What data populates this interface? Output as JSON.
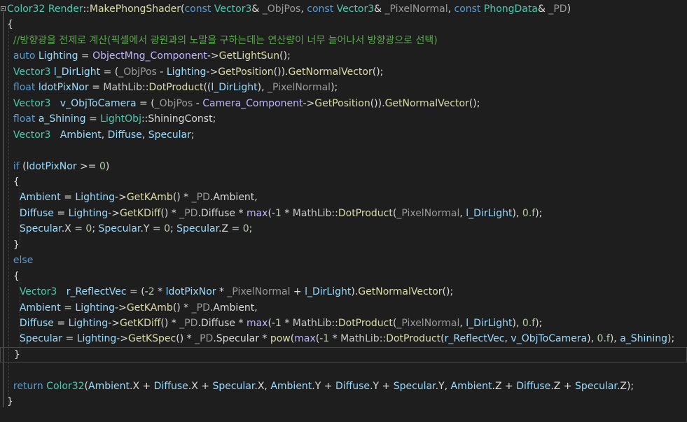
{
  "code": {
    "lines": [
      [
        {
          "t": "Color32",
          "c": "type"
        },
        {
          "t": " ",
          "c": "text"
        },
        {
          "t": "Render",
          "c": "type"
        },
        {
          "t": "::",
          "c": "text"
        },
        {
          "t": "MakePhongShader",
          "c": "func"
        },
        {
          "t": "(",
          "c": "text"
        },
        {
          "t": "const",
          "c": "keyword"
        },
        {
          "t": " ",
          "c": "text"
        },
        {
          "t": "Vector3",
          "c": "type"
        },
        {
          "t": "& ",
          "c": "text"
        },
        {
          "t": "_ObjPos",
          "c": "param"
        },
        {
          "t": ", ",
          "c": "text"
        },
        {
          "t": "const",
          "c": "keyword"
        },
        {
          "t": " ",
          "c": "text"
        },
        {
          "t": "Vector3",
          "c": "type"
        },
        {
          "t": "& ",
          "c": "text"
        },
        {
          "t": "_PixelNormal",
          "c": "param"
        },
        {
          "t": ", ",
          "c": "text"
        },
        {
          "t": "const",
          "c": "keyword"
        },
        {
          "t": " ",
          "c": "text"
        },
        {
          "t": "PhongData",
          "c": "type"
        },
        {
          "t": "& ",
          "c": "text"
        },
        {
          "t": "_PD",
          "c": "param"
        },
        {
          "t": ")",
          "c": "text"
        }
      ],
      [
        {
          "t": "{",
          "c": "text"
        }
      ],
      [
        {
          "t": "  ",
          "c": "text"
        },
        {
          "t": "//방향광을 전제로 계산(픽셀에서 광원과의 노말을 구하는데는 연산량이 너무 늘어나서 방향광으로 선택)",
          "c": "comment"
        }
      ],
      [
        {
          "t": "  ",
          "c": "text"
        },
        {
          "t": "auto",
          "c": "keyword"
        },
        {
          "t": " ",
          "c": "text"
        },
        {
          "t": "Lighting",
          "c": "variable"
        },
        {
          "t": " = ",
          "c": "text"
        },
        {
          "t": "ObjectMng_Component",
          "c": "macro"
        },
        {
          "t": "->",
          "c": "text"
        },
        {
          "t": "GetLightSun",
          "c": "func"
        },
        {
          "t": "();",
          "c": "text"
        }
      ],
      [
        {
          "t": "  ",
          "c": "text"
        },
        {
          "t": "Vector3",
          "c": "type"
        },
        {
          "t": " ",
          "c": "text"
        },
        {
          "t": "l_DirLight",
          "c": "variable"
        },
        {
          "t": " = (",
          "c": "text"
        },
        {
          "t": "_ObjPos",
          "c": "param"
        },
        {
          "t": " - ",
          "c": "text"
        },
        {
          "t": "Lighting",
          "c": "variable"
        },
        {
          "t": "->",
          "c": "text"
        },
        {
          "t": "GetPosition",
          "c": "func"
        },
        {
          "t": "()).",
          "c": "text"
        },
        {
          "t": "GetNormalVector",
          "c": "func"
        },
        {
          "t": "();",
          "c": "text"
        }
      ],
      [
        {
          "t": "  ",
          "c": "text"
        },
        {
          "t": "float",
          "c": "keyword"
        },
        {
          "t": " ",
          "c": "text"
        },
        {
          "t": "ldotPixNor",
          "c": "variable"
        },
        {
          "t": " = ",
          "c": "text"
        },
        {
          "t": "MathLib",
          "c": "namespace"
        },
        {
          "t": "::",
          "c": "text"
        },
        {
          "t": "DotProduct",
          "c": "func"
        },
        {
          "t": "((",
          "c": "text"
        },
        {
          "t": "l_DirLight",
          "c": "variable"
        },
        {
          "t": "), ",
          "c": "text"
        },
        {
          "t": "_PixelNormal",
          "c": "param"
        },
        {
          "t": ");",
          "c": "text"
        }
      ],
      [
        {
          "t": "  ",
          "c": "text"
        },
        {
          "t": "Vector3",
          "c": "type"
        },
        {
          "t": "   ",
          "c": "text"
        },
        {
          "t": "v_ObjToCamera",
          "c": "variable"
        },
        {
          "t": " = (",
          "c": "text"
        },
        {
          "t": "_ObjPos",
          "c": "param"
        },
        {
          "t": " - ",
          "c": "text"
        },
        {
          "t": "Camera_Component",
          "c": "macro"
        },
        {
          "t": "->",
          "c": "text"
        },
        {
          "t": "GetPosition",
          "c": "func"
        },
        {
          "t": "()).",
          "c": "text"
        },
        {
          "t": "GetNormalVector",
          "c": "func"
        },
        {
          "t": "();",
          "c": "text"
        }
      ],
      [
        {
          "t": "  ",
          "c": "text"
        },
        {
          "t": "float",
          "c": "keyword"
        },
        {
          "t": " ",
          "c": "text"
        },
        {
          "t": "a_Shining",
          "c": "variable"
        },
        {
          "t": " = ",
          "c": "text"
        },
        {
          "t": "LightObj",
          "c": "type"
        },
        {
          "t": "::",
          "c": "text"
        },
        {
          "t": "ShiningConst",
          "c": "member"
        },
        {
          "t": ";",
          "c": "text"
        }
      ],
      [
        {
          "t": "  ",
          "c": "text"
        },
        {
          "t": "Vector3",
          "c": "type"
        },
        {
          "t": "   ",
          "c": "text"
        },
        {
          "t": "Ambient",
          "c": "variable"
        },
        {
          "t": ", ",
          "c": "text"
        },
        {
          "t": "Diffuse",
          "c": "variable"
        },
        {
          "t": ", ",
          "c": "text"
        },
        {
          "t": "Specular",
          "c": "variable"
        },
        {
          "t": ";",
          "c": "text"
        }
      ],
      [
        {
          "t": "",
          "c": "text"
        }
      ],
      [
        {
          "t": "  ",
          "c": "text"
        },
        {
          "t": "if",
          "c": "keyword"
        },
        {
          "t": " (",
          "c": "text"
        },
        {
          "t": "ldotPixNor",
          "c": "variable"
        },
        {
          "t": " >= ",
          "c": "text"
        },
        {
          "t": "0",
          "c": "number"
        },
        {
          "t": ")",
          "c": "text"
        }
      ],
      [
        {
          "t": "  {",
          "c": "text"
        }
      ],
      [
        {
          "t": "    ",
          "c": "text"
        },
        {
          "t": "Ambient",
          "c": "variable"
        },
        {
          "t": " = ",
          "c": "text"
        },
        {
          "t": "Lighting",
          "c": "variable"
        },
        {
          "t": "->",
          "c": "text"
        },
        {
          "t": "GetKAmb",
          "c": "func"
        },
        {
          "t": "() * ",
          "c": "text"
        },
        {
          "t": "_PD",
          "c": "param"
        },
        {
          "t": ".",
          "c": "text"
        },
        {
          "t": "Ambient",
          "c": "member"
        },
        {
          "t": ",",
          "c": "text"
        }
      ],
      [
        {
          "t": "    ",
          "c": "text"
        },
        {
          "t": "Diffuse",
          "c": "variable"
        },
        {
          "t": " = ",
          "c": "text"
        },
        {
          "t": "Lighting",
          "c": "variable"
        },
        {
          "t": "->",
          "c": "text"
        },
        {
          "t": "GetKDiff",
          "c": "func"
        },
        {
          "t": "() * ",
          "c": "text"
        },
        {
          "t": "_PD",
          "c": "param"
        },
        {
          "t": ".",
          "c": "text"
        },
        {
          "t": "Diffuse",
          "c": "member"
        },
        {
          "t": " * ",
          "c": "text"
        },
        {
          "t": "max",
          "c": "macro"
        },
        {
          "t": "(-",
          "c": "text"
        },
        {
          "t": "1",
          "c": "number"
        },
        {
          "t": " * ",
          "c": "text"
        },
        {
          "t": "MathLib",
          "c": "namespace"
        },
        {
          "t": "::",
          "c": "text"
        },
        {
          "t": "DotProduct",
          "c": "func"
        },
        {
          "t": "(",
          "c": "text"
        },
        {
          "t": "_PixelNormal",
          "c": "param"
        },
        {
          "t": ", ",
          "c": "text"
        },
        {
          "t": "l_DirLight",
          "c": "variable"
        },
        {
          "t": "), ",
          "c": "text"
        },
        {
          "t": "0.f",
          "c": "number"
        },
        {
          "t": ");",
          "c": "text"
        }
      ],
      [
        {
          "t": "    ",
          "c": "text"
        },
        {
          "t": "Specular",
          "c": "variable"
        },
        {
          "t": ".",
          "c": "text"
        },
        {
          "t": "X",
          "c": "member"
        },
        {
          "t": " = ",
          "c": "text"
        },
        {
          "t": "0",
          "c": "number"
        },
        {
          "t": "; ",
          "c": "text"
        },
        {
          "t": "Specular",
          "c": "variable"
        },
        {
          "t": ".",
          "c": "text"
        },
        {
          "t": "Y",
          "c": "member"
        },
        {
          "t": " = ",
          "c": "text"
        },
        {
          "t": "0",
          "c": "number"
        },
        {
          "t": "; ",
          "c": "text"
        },
        {
          "t": "Specular",
          "c": "variable"
        },
        {
          "t": ".",
          "c": "text"
        },
        {
          "t": "Z",
          "c": "member"
        },
        {
          "t": " = ",
          "c": "text"
        },
        {
          "t": "0",
          "c": "number"
        },
        {
          "t": ";",
          "c": "text"
        }
      ],
      [
        {
          "t": "  }",
          "c": "text"
        }
      ],
      [
        {
          "t": "  ",
          "c": "text"
        },
        {
          "t": "else",
          "c": "keyword"
        }
      ],
      [
        {
          "t": "  {",
          "c": "text"
        }
      ],
      [
        {
          "t": "    ",
          "c": "text"
        },
        {
          "t": "Vector3",
          "c": "type"
        },
        {
          "t": "   ",
          "c": "text"
        },
        {
          "t": "r_ReflectVec",
          "c": "variable"
        },
        {
          "t": " = (-",
          "c": "text"
        },
        {
          "t": "2",
          "c": "number"
        },
        {
          "t": " * ",
          "c": "text"
        },
        {
          "t": "ldotPixNor",
          "c": "variable"
        },
        {
          "t": " * ",
          "c": "text"
        },
        {
          "t": "_PixelNormal",
          "c": "param"
        },
        {
          "t": " + ",
          "c": "text"
        },
        {
          "t": "l_DirLight",
          "c": "variable"
        },
        {
          "t": ").",
          "c": "text"
        },
        {
          "t": "GetNormalVector",
          "c": "func"
        },
        {
          "t": "();",
          "c": "text"
        }
      ],
      [
        {
          "t": "    ",
          "c": "text"
        },
        {
          "t": "Ambient",
          "c": "variable"
        },
        {
          "t": " = ",
          "c": "text"
        },
        {
          "t": "Lighting",
          "c": "variable"
        },
        {
          "t": "->",
          "c": "text"
        },
        {
          "t": "GetKAmb",
          "c": "func"
        },
        {
          "t": "() * ",
          "c": "text"
        },
        {
          "t": "_PD",
          "c": "param"
        },
        {
          "t": ".",
          "c": "text"
        },
        {
          "t": "Ambient",
          "c": "member"
        },
        {
          "t": ",",
          "c": "text"
        }
      ],
      [
        {
          "t": "    ",
          "c": "text"
        },
        {
          "t": "Diffuse",
          "c": "variable"
        },
        {
          "t": " = ",
          "c": "text"
        },
        {
          "t": "Lighting",
          "c": "variable"
        },
        {
          "t": "->",
          "c": "text"
        },
        {
          "t": "GetKDiff",
          "c": "func"
        },
        {
          "t": "() * ",
          "c": "text"
        },
        {
          "t": "_PD",
          "c": "param"
        },
        {
          "t": ".",
          "c": "text"
        },
        {
          "t": "Diffuse",
          "c": "member"
        },
        {
          "t": " * ",
          "c": "text"
        },
        {
          "t": "max",
          "c": "macro"
        },
        {
          "t": "(-",
          "c": "text"
        },
        {
          "t": "1",
          "c": "number"
        },
        {
          "t": " * ",
          "c": "text"
        },
        {
          "t": "MathLib",
          "c": "namespace"
        },
        {
          "t": "::",
          "c": "text"
        },
        {
          "t": "DotProduct",
          "c": "func"
        },
        {
          "t": "(",
          "c": "text"
        },
        {
          "t": "_PixelNormal",
          "c": "param"
        },
        {
          "t": ", ",
          "c": "text"
        },
        {
          "t": "l_DirLight",
          "c": "variable"
        },
        {
          "t": "), ",
          "c": "text"
        },
        {
          "t": "0.f",
          "c": "number"
        },
        {
          "t": ");",
          "c": "text"
        }
      ],
      [
        {
          "t": "    ",
          "c": "text"
        },
        {
          "t": "Specular",
          "c": "variable"
        },
        {
          "t": " = ",
          "c": "text"
        },
        {
          "t": "Lighting",
          "c": "variable"
        },
        {
          "t": "->",
          "c": "text"
        },
        {
          "t": "GetKSpec",
          "c": "func"
        },
        {
          "t": "() * ",
          "c": "text"
        },
        {
          "t": "_PD",
          "c": "param"
        },
        {
          "t": ".",
          "c": "text"
        },
        {
          "t": "Specular",
          "c": "member"
        },
        {
          "t": " * ",
          "c": "text"
        },
        {
          "t": "pow",
          "c": "func"
        },
        {
          "t": "(",
          "c": "text"
        },
        {
          "t": "max",
          "c": "macro"
        },
        {
          "t": "(-",
          "c": "text"
        },
        {
          "t": "1",
          "c": "number"
        },
        {
          "t": " * ",
          "c": "text"
        },
        {
          "t": "MathLib",
          "c": "namespace"
        },
        {
          "t": "::",
          "c": "text"
        },
        {
          "t": "DotProduct",
          "c": "func"
        },
        {
          "t": "(",
          "c": "text"
        },
        {
          "t": "r_ReflectVec",
          "c": "variable"
        },
        {
          "t": ", ",
          "c": "text"
        },
        {
          "t": "v_ObjToCamera",
          "c": "variable"
        },
        {
          "t": "), ",
          "c": "text"
        },
        {
          "t": "0.f",
          "c": "number"
        },
        {
          "t": "), ",
          "c": "text"
        },
        {
          "t": "a_Shining",
          "c": "variable"
        },
        {
          "t": ");",
          "c": "text"
        }
      ],
      [
        {
          "t": "  }",
          "c": "text"
        }
      ],
      [
        {
          "t": "",
          "c": "text"
        }
      ],
      [
        {
          "t": "  ",
          "c": "text"
        },
        {
          "t": "return",
          "c": "keyword"
        },
        {
          "t": " ",
          "c": "text"
        },
        {
          "t": "Color32",
          "c": "type"
        },
        {
          "t": "(",
          "c": "text"
        },
        {
          "t": "Ambient",
          "c": "variable"
        },
        {
          "t": ".",
          "c": "text"
        },
        {
          "t": "X",
          "c": "member"
        },
        {
          "t": " + ",
          "c": "text"
        },
        {
          "t": "Diffuse",
          "c": "variable"
        },
        {
          "t": ".",
          "c": "text"
        },
        {
          "t": "X",
          "c": "member"
        },
        {
          "t": " + ",
          "c": "text"
        },
        {
          "t": "Specular",
          "c": "variable"
        },
        {
          "t": ".",
          "c": "text"
        },
        {
          "t": "X",
          "c": "member"
        },
        {
          "t": ", ",
          "c": "text"
        },
        {
          "t": "Ambient",
          "c": "variable"
        },
        {
          "t": ".",
          "c": "text"
        },
        {
          "t": "Y",
          "c": "member"
        },
        {
          "t": " + ",
          "c": "text"
        },
        {
          "t": "Diffuse",
          "c": "variable"
        },
        {
          "t": ".",
          "c": "text"
        },
        {
          "t": "Y",
          "c": "member"
        },
        {
          "t": " + ",
          "c": "text"
        },
        {
          "t": "Specular",
          "c": "variable"
        },
        {
          "t": ".",
          "c": "text"
        },
        {
          "t": "Y",
          "c": "member"
        },
        {
          "t": ", ",
          "c": "text"
        },
        {
          "t": "Ambient",
          "c": "variable"
        },
        {
          "t": ".",
          "c": "text"
        },
        {
          "t": "Z",
          "c": "member"
        },
        {
          "t": " + ",
          "c": "text"
        },
        {
          "t": "Diffuse",
          "c": "variable"
        },
        {
          "t": ".",
          "c": "text"
        },
        {
          "t": "Z",
          "c": "member"
        },
        {
          "t": " + ",
          "c": "text"
        },
        {
          "t": "Specular",
          "c": "variable"
        },
        {
          "t": ".",
          "c": "text"
        },
        {
          "t": "Z",
          "c": "member"
        },
        {
          "t": ");",
          "c": "text"
        }
      ],
      [
        {
          "t": "}",
          "c": "text"
        }
      ]
    ],
    "current_line": 22
  },
  "colors": {
    "background": "#1e1e1e",
    "keyword": "#569cd6",
    "type": "#4ec9b0",
    "function": "#dcdcaa",
    "comment": "#57a64a",
    "variable": "#9cdcfe",
    "number": "#b5cea8",
    "macro": "#beb7ff"
  }
}
